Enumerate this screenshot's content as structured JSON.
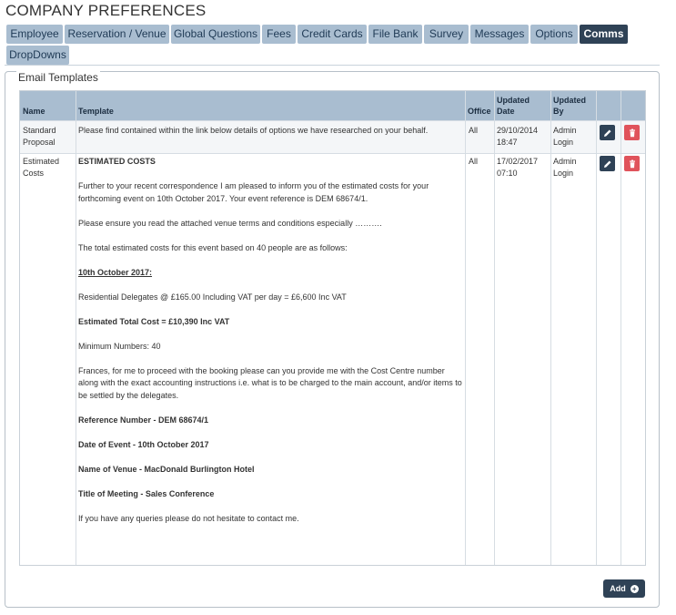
{
  "page": {
    "title": "COMPANY PREFERENCES"
  },
  "tabs": [
    {
      "label": "Employee",
      "active": false
    },
    {
      "label": "Reservation / Venue",
      "active": false
    },
    {
      "label": "Global Questions",
      "active": false
    },
    {
      "label": "Fees",
      "active": false
    },
    {
      "label": "Credit Cards",
      "active": false
    },
    {
      "label": "File Bank",
      "active": false
    },
    {
      "label": "Survey",
      "active": false
    },
    {
      "label": "Messages",
      "active": false
    },
    {
      "label": "Options",
      "active": false
    },
    {
      "label": "Comms",
      "active": true
    },
    {
      "label": "DropDowns",
      "active": false
    }
  ],
  "panel": {
    "legend": "Email Templates"
  },
  "table": {
    "headers": {
      "name": "Name",
      "template": "Template",
      "office": "Office",
      "updated_date_1": "Updated",
      "updated_date_2": "Date",
      "updated_by_1": "Updated",
      "updated_by_2": "By"
    },
    "rows": [
      {
        "name_1": "Standard",
        "name_2": "Proposal",
        "template_lines": [
          {
            "text": "Please find contained within the link below details of options we have researched on your behalf.",
            "style": ""
          }
        ],
        "office": "All",
        "updated_date_1": "29/10/2014",
        "updated_date_2": "18:47",
        "updated_by_1": "Admin",
        "updated_by_2": "Login"
      },
      {
        "name_1": "Estimated",
        "name_2": "Costs",
        "template_lines": [
          {
            "text": "ESTIMATED COSTS",
            "style": "bold"
          },
          {
            "text": "",
            "style": ""
          },
          {
            "text": "Further to your recent correspondence I am pleased to inform you of the estimated costs for your",
            "style": ""
          },
          {
            "text": "forthcoming event on 10th October 2017. Your event reference is DEM 68674/1.",
            "style": ""
          },
          {
            "text": "",
            "style": ""
          },
          {
            "text": "Please ensure you read the attached venue terms and conditions especially ……….",
            "style": ""
          },
          {
            "text": "",
            "style": ""
          },
          {
            "text": "The total estimated costs for this event based on 40 people are as follows:",
            "style": ""
          },
          {
            "text": "",
            "style": ""
          },
          {
            "text": "10th October 2017:",
            "style": "bold underline"
          },
          {
            "text": "",
            "style": ""
          },
          {
            "text": "Residential Delegates @ £165.00 Including VAT per day  = £6,600 Inc VAT",
            "style": ""
          },
          {
            "text": "",
            "style": ""
          },
          {
            "text": "Estimated Total Cost = £10,390 Inc VAT",
            "style": "bold"
          },
          {
            "text": "",
            "style": ""
          },
          {
            "text": "Minimum Numbers: 40",
            "style": ""
          },
          {
            "text": "",
            "style": ""
          },
          {
            "text": "Frances, for me to proceed with the booking please can you provide me with the Cost Centre number",
            "style": ""
          },
          {
            "text": "along with the exact accounting instructions i.e. what is to be charged to the main account, and/or items to",
            "style": ""
          },
          {
            "text": "be settled by the delegates.",
            "style": ""
          },
          {
            "text": "",
            "style": ""
          },
          {
            "text": "Reference Number - DEM 68674/1",
            "style": "bold"
          },
          {
            "text": "",
            "style": ""
          },
          {
            "text": "Date of Event - 10th October 2017",
            "style": "bold"
          },
          {
            "text": "",
            "style": ""
          },
          {
            "text": "Name of Venue - MacDonald Burlington Hotel",
            "style": "bold"
          },
          {
            "text": "",
            "style": ""
          },
          {
            "text": "Title of Meeting - Sales Conference",
            "style": "bold"
          },
          {
            "text": "",
            "style": ""
          },
          {
            "text": "If you have any queries please do not hesitate to contact me.",
            "style": ""
          }
        ],
        "office": "All",
        "updated_date_1": "17/02/2017",
        "updated_date_2": "07:10",
        "updated_by_1": "Admin",
        "updated_by_2": "Login"
      }
    ]
  },
  "actions": {
    "add_label": "Add"
  },
  "icons": {
    "edit": "pencil-icon",
    "delete": "trash-icon",
    "add": "plus-circle-icon"
  },
  "colors": {
    "tab_bg": "#a9bdd0",
    "tab_active_bg": "#2f4256",
    "edit_btn": "#2f4256",
    "delete_btn": "#e0535b"
  }
}
